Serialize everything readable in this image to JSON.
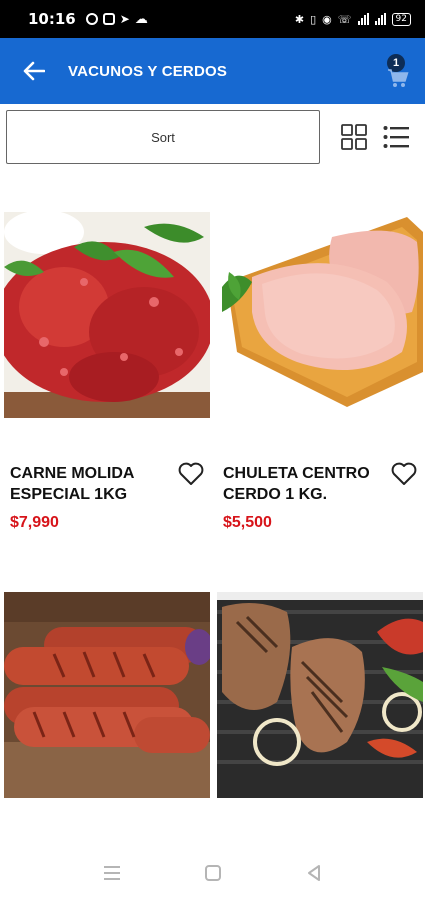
{
  "status_bar": {
    "time": "10:16",
    "battery": "92"
  },
  "app_bar": {
    "title": "VACUNOS Y CERDOS",
    "cart_count": "1"
  },
  "toolbar": {
    "sort_label": "Sort"
  },
  "products": [
    {
      "name": "CARNE MOLIDA ESPECIAL 1KG",
      "price": "$7,990",
      "image": "ground-beef"
    },
    {
      "name": "CHULETA CENTRO CERDO 1 KG.",
      "price": "$5,500",
      "image": "pork-chop"
    },
    {
      "name": "",
      "price": "",
      "image": "sausages"
    },
    {
      "name": "",
      "price": "",
      "image": "grilled-meat"
    }
  ],
  "colors": {
    "app_bar": "#1769d1",
    "price": "#d7141a"
  }
}
